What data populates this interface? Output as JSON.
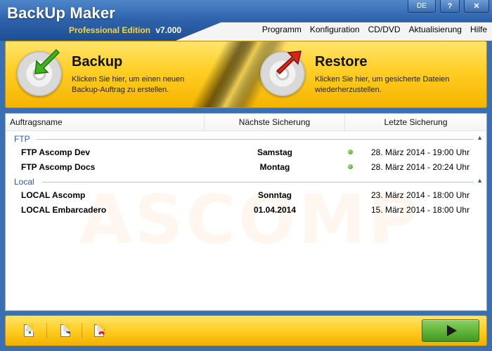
{
  "app": {
    "title": "BackUp Maker",
    "edition": "Professional Edition",
    "version": "v7.000"
  },
  "window_buttons": {
    "language": "DE",
    "help": "?",
    "close": "✕"
  },
  "menu": [
    "Programm",
    "Konfiguration",
    "CD/DVD",
    "Aktualisierung",
    "Hilfe"
  ],
  "actions": {
    "backup": {
      "title": "Backup",
      "desc_line1": "Klicken Sie hier, um einen neuen",
      "desc_line2": "Backup-Auftrag zu erstellen."
    },
    "restore": {
      "title": "Restore",
      "desc_line1": "Klicken Sie hier, um gesicherte Dateien",
      "desc_line2": "wiederherzustellen."
    }
  },
  "list": {
    "columns": [
      "Auftragsname",
      "Nächste Sicherung",
      "Letzte Sicherung"
    ],
    "groups": [
      {
        "label": "FTP",
        "jobs": [
          {
            "name": "FTP Ascomp Dev",
            "next": "Samstag",
            "last": "28. März 2014 - 19:00 Uhr",
            "status_dot": true
          },
          {
            "name": "FTP Ascomp Docs",
            "next": "Montag",
            "last": "28. März 2014 - 20:24 Uhr",
            "status_dot": true
          }
        ]
      },
      {
        "label": "Local",
        "jobs": [
          {
            "name": "LOCAL Ascomp",
            "next": "Sonntag",
            "last": "23. März 2014 - 18:00 Uhr",
            "status_dot": false
          },
          {
            "name": "LOCAL Embarcadero",
            "next": "01.04.2014",
            "last": "15. März 2014 - 18:00 Uhr",
            "status_dot": false
          }
        ]
      }
    ],
    "watermark": "ASCOMP"
  },
  "colors": {
    "accent_yellow": "#ffce25",
    "title_blue": "#2d62ab",
    "group_blue": "#2a5aa8",
    "status_green": "#3c9a1e",
    "run_green": "#3f9a1d"
  },
  "icons": {
    "backup": "disc-with-green-arrow-icon",
    "restore": "disc-with-red-arrow-icon",
    "add": "add-job-icon",
    "edit": "edit-job-icon",
    "delete": "delete-job-icon",
    "run": "play-icon"
  }
}
